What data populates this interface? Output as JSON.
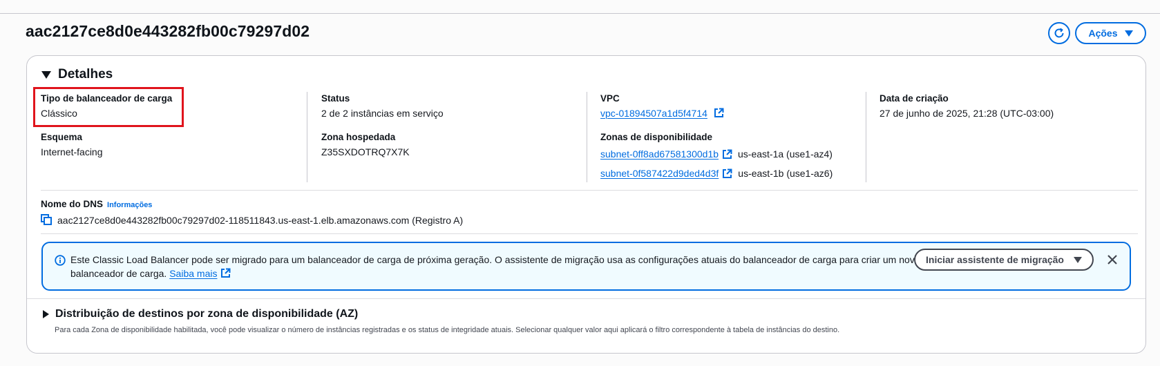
{
  "header": {
    "title": "aac2127ce8d0e443282fb00c79297d02",
    "refresh_icon": "refresh-icon",
    "actions_label": "Ações"
  },
  "details": {
    "section_title": "Detalhes",
    "lb_type_label": "Tipo de balanceador de carga",
    "lb_type_value": "Clássico",
    "scheme_label": "Esquema",
    "scheme_value": "Internet-facing",
    "status_label": "Status",
    "status_value": "2 de 2 instâncias em serviço",
    "hosted_zone_label": "Zona hospedada",
    "hosted_zone_value": "Z35SXDOTRQ7X7K",
    "vpc_label": "VPC",
    "vpc_value": "vpc-01894507a1d5f4714",
    "az_label": "Zonas de disponibilidade",
    "zones": [
      {
        "subnet": "subnet-0ff8ad67581300d1b",
        "az": "us-east-1a (use1-az4)"
      },
      {
        "subnet": "subnet-0f587422d9ded4d3f",
        "az": "us-east-1b (use1-az6)"
      }
    ],
    "created_label": "Data de criação",
    "created_value": "27 de junho de 2025, 21:28 (UTC-03:00)",
    "dns_label": "Nome do DNS",
    "dns_info": "Informações",
    "dns_value": "aac2127ce8d0e443282fb00c79297d02-118511843.us-east-1.elb.amazonaws.com (Registro A)"
  },
  "flash": {
    "message": "Este Classic Load Balancer pode ser migrado para um balanceador de carga de próxima geração. O assistente de migração usa as configurações atuais do balanceador de carga para criar um novo balanceador de carga.",
    "learn_more": "Saiba mais",
    "migrate_button": "Iniciar assistente de migração"
  },
  "az_distribution": {
    "title": "Distribuição de destinos por zona de disponibilidade (AZ)",
    "description": "Para cada Zona de disponibilidade habilitada, você pode visualizar o número de instâncias registradas e os status de integridade atuais. Selecionar qualquer valor aqui aplicará o filtro correspondente à tabela de instâncias do destino."
  },
  "colors": {
    "accent": "#006ce0",
    "highlight": "#e0141c",
    "info_bg": "#f0fbff"
  }
}
